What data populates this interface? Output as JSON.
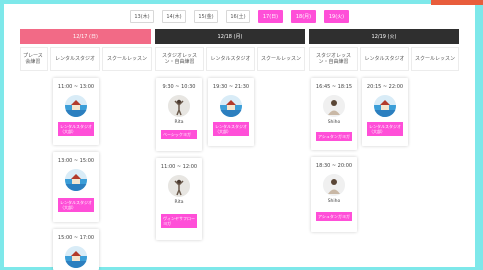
{
  "date_tabs": [
    "13(木)",
    "14(木)",
    "15(金)",
    "16(土)",
    "17(日)",
    "18(月)",
    "19(火)"
  ],
  "days": [
    {
      "label": "12/17 (日)"
    },
    {
      "label": "12/18 (月)"
    },
    {
      "label": "12/19 (火)"
    }
  ],
  "categories": {
    "col0": "プレース\n会練習",
    "col1": "レンタルスタジオ",
    "col2": "スクールレッスン",
    "col3": "スタジオレッスン・自由練習",
    "col4": "レンタルスタジオ",
    "col5": "スクールレッスン",
    "col6": "スタジオレッスン・自由練習",
    "col7": "レンタルスタジオ",
    "col8": "スクールレッスン"
  },
  "cards": [
    {
      "time": "11:00 ~ 13:00",
      "name": "",
      "tag": "レンタルスタジオ（大部）"
    },
    {
      "time": "13:00 ~ 15:00",
      "name": "",
      "tag": "レンタルスタジオ（大部）"
    },
    {
      "time": "15:00 ~ 17:00",
      "name": "",
      "tag": ""
    },
    {
      "time": "9:30 ~ 10:30",
      "name": "Rita",
      "tag": "ベーシックヨガ"
    },
    {
      "time": "19:30 ~ 21:30",
      "name": "",
      "tag": "レンタルスタジオ（大部）"
    },
    {
      "time": "11:00 ~ 12:00",
      "name": "Rita",
      "tag": "ヴィンヤサフローヨガ"
    },
    {
      "time": "16:45 ~ 18:15",
      "name": "Shiho",
      "tag": "アシュタンガヨガ"
    },
    {
      "time": "20:15 ~ 22:00",
      "name": "",
      "tag": "レンタルスタジオ（大部）"
    },
    {
      "time": "18:30 ~ 20:00",
      "name": "Shiho",
      "tag": "アシュタンガヨガ"
    }
  ],
  "colors": {
    "accent": "#ff4fd8",
    "today_header": "#f26a86",
    "dark_header": "#2f2f2f",
    "frame": "#7ee8ea"
  }
}
